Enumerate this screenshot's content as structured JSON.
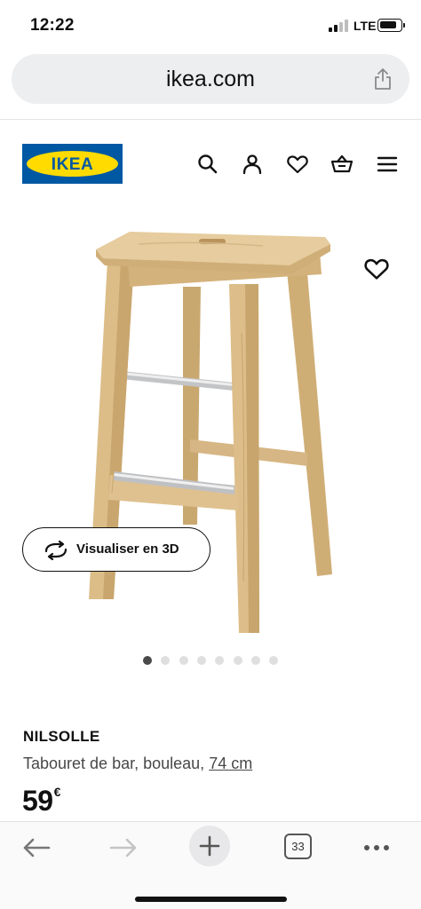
{
  "status": {
    "time": "12:22",
    "network": "LTE",
    "battery_level": 0.85
  },
  "browser": {
    "url": "ikea.com"
  },
  "header": {
    "logo_text": "IKEA",
    "icons": [
      "search-icon",
      "account-icon",
      "wishlist-icon",
      "cart-icon",
      "menu-icon"
    ],
    "colors": {
      "logo_blue": "#0058a3",
      "logo_yellow": "#ffdb00"
    }
  },
  "product": {
    "name": "NILSOLLE",
    "description": "Tabouret de bar, bouleau,",
    "size": "74 cm",
    "price": "59",
    "currency": "€",
    "visualize_label": "Visualiser en 3D",
    "gallery": {
      "count": 8,
      "active": 1
    }
  },
  "bottom_toolbar": {
    "tab_count": "33",
    "icons": [
      "back-arrow-icon",
      "forward-arrow-icon",
      "new-tab-icon",
      "tabs-icon",
      "more-icon"
    ]
  }
}
